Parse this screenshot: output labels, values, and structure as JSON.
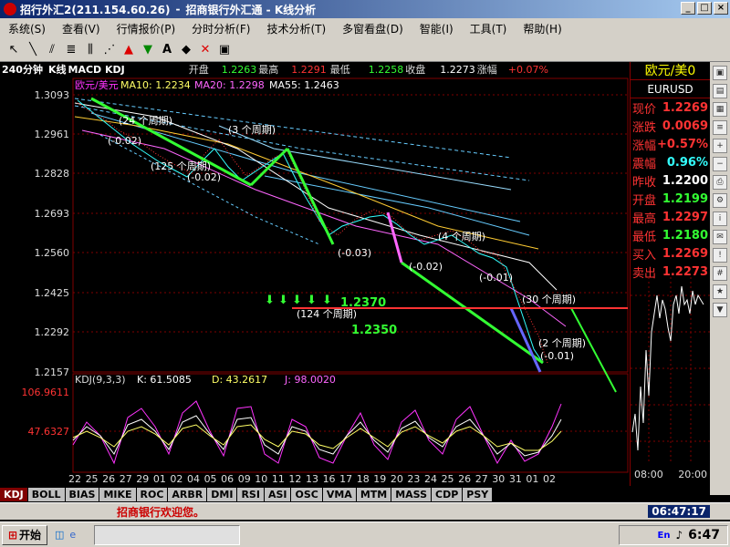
{
  "window": {
    "title": "招商银行外汇通 - K线分析",
    "app_name": "招行外汇2(211.154.60.26)"
  },
  "menu": [
    "系统(S)",
    "查看(V)",
    "行情报价(P)",
    "分时分析(F)",
    "技术分析(T)",
    "多窗看盘(D)",
    "智能(I)",
    "工具(T)",
    "帮助(H)"
  ],
  "toolbar_icons": [
    "cursor-icon",
    "line-icon",
    "parallel-icon",
    "fibonacci-icon",
    "cycle-icon",
    "gann-icon",
    "up-arrow-icon",
    "down-arrow-icon",
    "text-icon",
    "eraser-icon",
    "delete-icon",
    "lock-icon"
  ],
  "header": {
    "period": "240分钟",
    "chart_type": "K线",
    "indicators": "MACD KDJ",
    "open_label": "开盘",
    "open": "1.2263",
    "high_label": "最高",
    "high": "1.2291",
    "low_label": "最低",
    "low": "1.2258",
    "close_label": "收盘",
    "close": "1.2273",
    "change_label": "涨幅",
    "change": "+0.07%"
  },
  "ma_line": {
    "symbol": "欧元/美元",
    "ma10": "MA10: 1.2234",
    "ma20": "MA20: 1.2298",
    "ma55": "MA55: 1.2463"
  },
  "price_axis": [
    "1.3093",
    "1.2961",
    "1.2828",
    "1.2693",
    "1.2560",
    "1.2425",
    "1.2292",
    "1.2157"
  ],
  "kdj": {
    "label": "KDJ(9,3,3)",
    "k": "K: 61.5085",
    "d": "D: 43.2617",
    "j": "J: 98.0020",
    "axis": [
      "106.9611",
      "47.6327"
    ]
  },
  "date_axis": [
    "22",
    "25",
    "26",
    "27",
    "29",
    "01",
    "02",
    "04",
    "05",
    "06",
    "09",
    "10",
    "11",
    "12",
    "13",
    "16",
    "17",
    "18",
    "19",
    "20",
    "23",
    "24",
    "25",
    "26",
    "27",
    "30",
    "31",
    "01",
    "02"
  ],
  "annotations": {
    "level_1": "1.2370",
    "level_2": "1.2350",
    "cycle_124": "(124 个周期)",
    "cycle_125": "(125 个周期)",
    "cycle_24": "(24 个周期)",
    "cycle_3": "(3 个周期)",
    "cycle_30": "(30 个周期)",
    "cycle_2": "(2 个周期)",
    "cycle_4": "(4 个周期)",
    "v1": "(-0.02)",
    "v2": "(-0.02)",
    "v3": "(-0.03)",
    "v4": "(-0.02)",
    "v5": "(-0.01)",
    "v6": "(-0.01)"
  },
  "quote_panel": {
    "title": "欧元/美0",
    "code": "EURUSD",
    "rows": [
      {
        "label": "现价",
        "value": "1.2269",
        "color": "#ff3333"
      },
      {
        "label": "涨跌",
        "value": "0.0069",
        "color": "#ff3333"
      },
      {
        "label": "涨幅",
        "value": "+0.57%",
        "color": "#ff3333"
      },
      {
        "label": "震幅",
        "value": "0.96%",
        "color": "#33ffff"
      },
      {
        "label": "昨收",
        "value": "1.2200",
        "color": "#ffffff"
      },
      {
        "label": "开盘",
        "value": "1.2199",
        "color": "#33ff33"
      },
      {
        "label": "最高",
        "value": "1.2297",
        "color": "#ff3333"
      },
      {
        "label": "最低",
        "value": "1.2180",
        "color": "#33ff33"
      },
      {
        "label": "买入",
        "value": "1.2269",
        "color": "#ff3333"
      },
      {
        "label": "卖出",
        "value": "1.2273",
        "color": "#ff3333"
      }
    ],
    "mini_time_start": "08:00",
    "mini_time_end": "20:00"
  },
  "tabs": [
    "KDJ",
    "BOLL",
    "BIAS",
    "MIKE",
    "ROC",
    "ARBR",
    "DMI",
    "RSI",
    "ASI",
    "OSC",
    "VMA",
    "MTM",
    "MASS",
    "CDP",
    "PSY"
  ],
  "status": {
    "message": "招商银行欢迎您。",
    "clock": "06:47:17"
  },
  "taskbar": {
    "start": "开始",
    "time": "6:47"
  },
  "colors": {
    "up": "#ff3333",
    "down": "#33ffff",
    "grid": "#800000",
    "accent_green": "#33ff33"
  }
}
